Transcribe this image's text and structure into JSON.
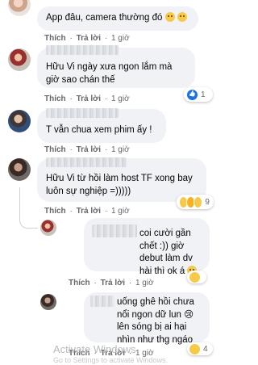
{
  "actions": {
    "like": "Thích",
    "reply": "Trả lời",
    "dot": "·"
  },
  "comments": [
    {
      "text": "App đâu, camera thường đó",
      "time": "1 giờ",
      "emoji": "laughing-face"
    },
    {
      "text": "Hữu Vi ngày xưa ngon lắm mà giờ sao chán thế",
      "time": "1 giờ",
      "reaction_count": "1"
    },
    {
      "text": "T vẫn chua xem phim ấy !",
      "time": "1 giờ"
    },
    {
      "text": "Hữu Vi từ hồi làm host TF xong bay luôn sự nghiệp =)))))",
      "time": "1 giờ",
      "reaction_count": "9"
    }
  ],
  "replies": [
    {
      "text": "coi cười gần chết :)) giờ debut làm dv hài thì ok á",
      "time": "1 giờ",
      "emoji": "heart-eyes-face"
    },
    {
      "text": "uống ghê hồi chưa nổi ngon dữ lun 😢 lên sóng bị ai hại nhìn như thg ngáo",
      "time": "1 giờ",
      "reaction_count": "4"
    }
  ],
  "watermark": {
    "title": "Activate Windows",
    "subtitle": "Go to Settings to activate Windows."
  },
  "colors": {
    "bubble": "#f0f2f5",
    "meta": "#65676b",
    "like": "#1b74e4"
  }
}
